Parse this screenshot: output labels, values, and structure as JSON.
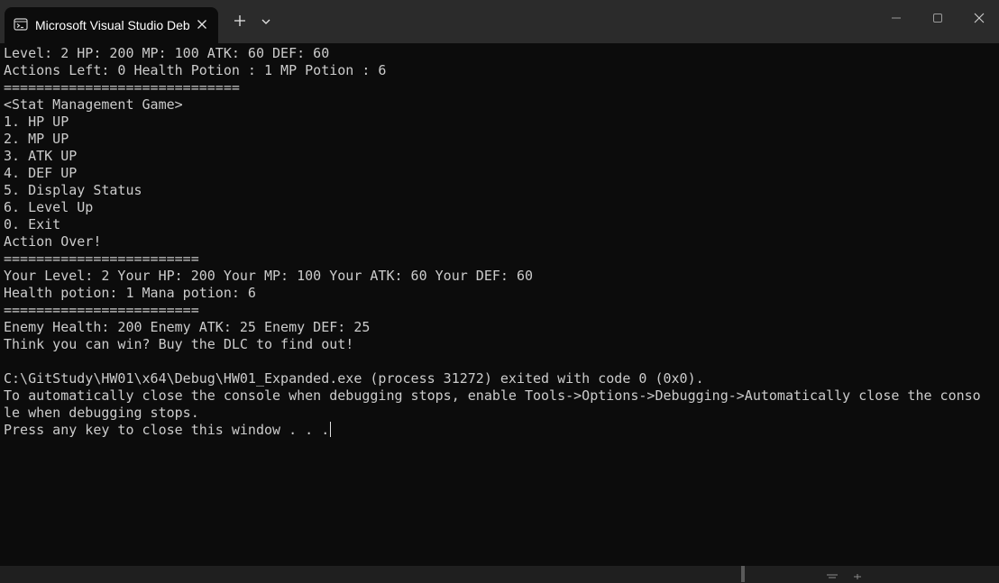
{
  "window": {
    "tab_title": "Microsoft Visual Studio Debug Console",
    "icons": {
      "terminal": "terminal-icon",
      "close_tab": "close-icon",
      "new_tab": "plus-icon",
      "dropdown": "chevron-down-icon",
      "minimize": "minimize-icon",
      "maximize": "maximize-icon",
      "close_window": "close-icon"
    }
  },
  "console": {
    "lines": [
      "Level: 2 HP: 200 MP: 100 ATK: 60 DEF: 60",
      "Actions Left: 0 Health Potion : 1 MP Potion : 6",
      "=============================",
      "<Stat Management Game>",
      "1. HP UP",
      "2. MP UP",
      "3. ATK UP",
      "4. DEF UP",
      "5. Display Status",
      "6. Level Up",
      "0. Exit",
      "Action Over!",
      "========================",
      "Your Level: 2 Your HP: 200 Your MP: 100 Your ATK: 60 Your DEF: 60",
      "Health potion: 1 Mana potion: 6",
      "========================",
      "Enemy Health: 200 Enemy ATK: 25 Enemy DEF: 25",
      "Think you can win? Buy the DLC to find out!",
      "",
      "C:\\GitStudy\\HW01\\x64\\Debug\\HW01_Expanded.exe (process 31272) exited with code 0 (0x0).",
      "To automatically close the console when debugging stops, enable Tools->Options->Debugging->Automatically close the conso",
      "le when debugging stops.",
      "Press any key to close this window . . ."
    ]
  },
  "colors": {
    "console_bg": "#0c0c0c",
    "console_text": "#cccccc",
    "titlebar_bg": "#2b2b2b",
    "taskbar_bg": "#1f1f1f"
  }
}
